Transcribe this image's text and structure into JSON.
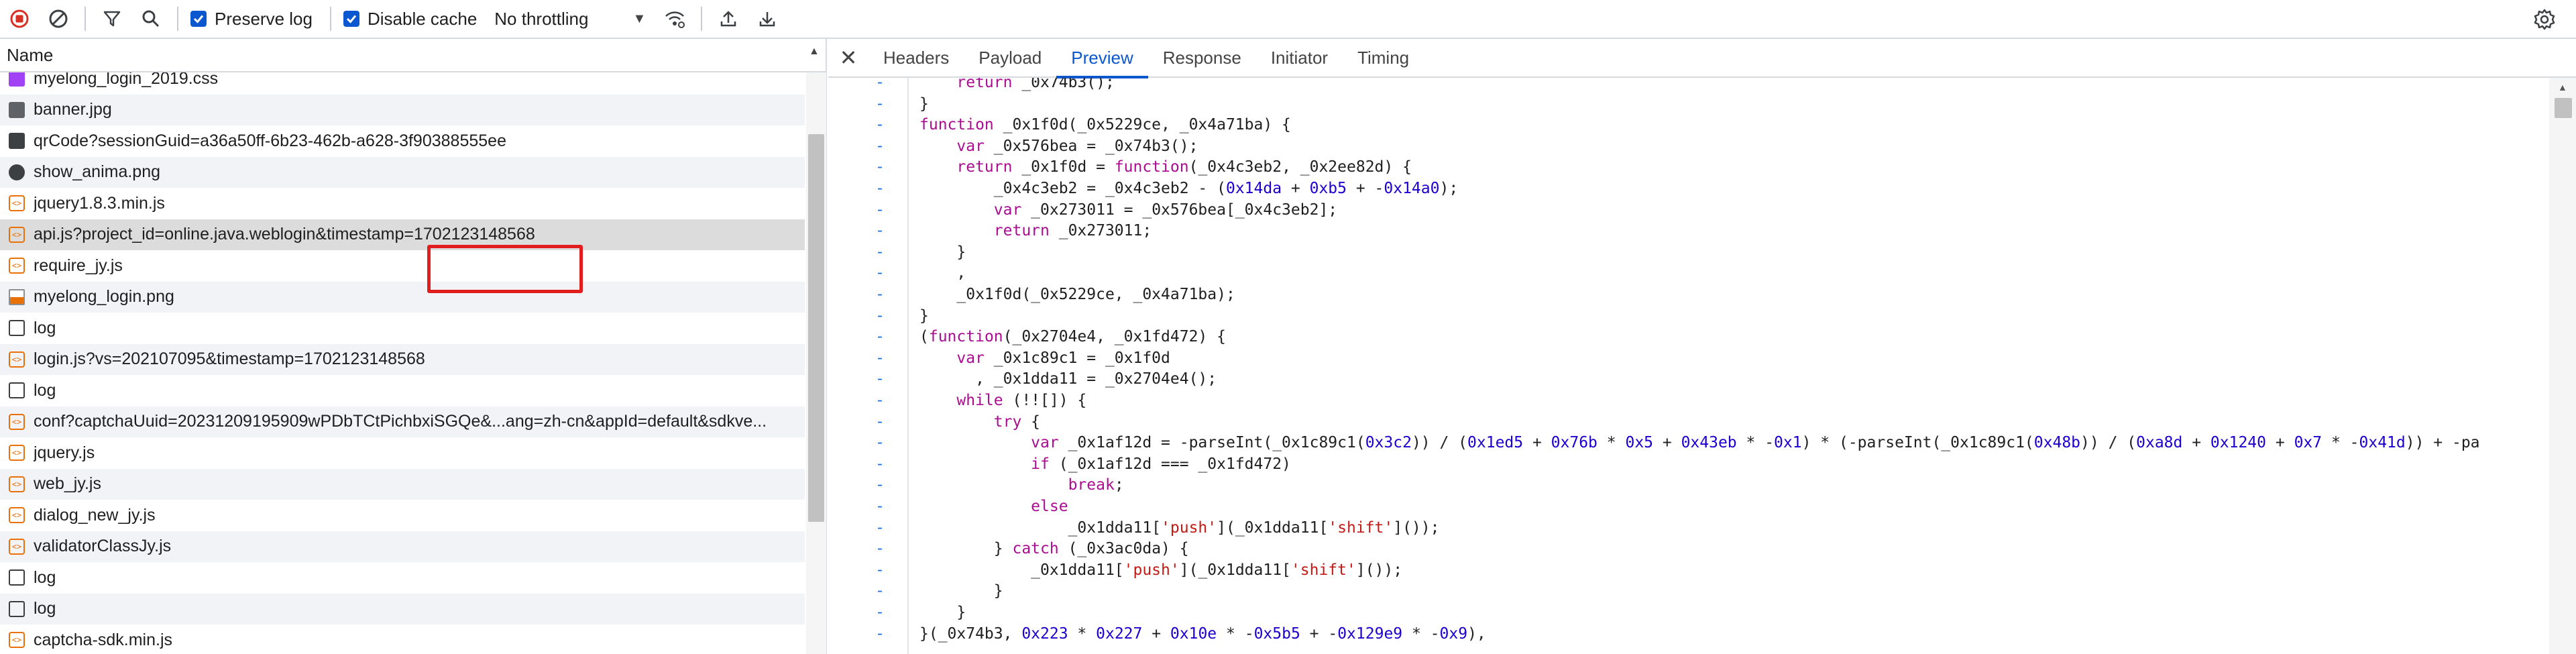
{
  "toolbar": {
    "record_icon": "record-stop-icon",
    "clear_icon": "clear-icon",
    "filter_icon": "filter-icon",
    "search_icon": "search-icon",
    "preserve_log_label": "Preserve log",
    "preserve_log_checked": true,
    "disable_cache_label": "Disable cache",
    "disable_cache_checked": true,
    "throttling_label": "No throttling",
    "network_conditions_icon": "network-conditions-icon",
    "import_icon": "upload-icon",
    "export_icon": "download-icon",
    "settings_icon": "gear-icon"
  },
  "list": {
    "header_name": "Name",
    "rows": [
      {
        "name": "myelong_login_2019.css",
        "type": "css"
      },
      {
        "name": "banner.jpg",
        "type": "img"
      },
      {
        "name": "qrCode?sessionGuid=a36a50ff-6b23-462b-a628-3f90388555ee",
        "type": "qr"
      },
      {
        "name": "show_anima.png",
        "type": "anim"
      },
      {
        "name": "jquery1.8.3.min.js",
        "type": "js"
      },
      {
        "name": "api.js?project_id=online.java.weblogin&timestamp=1702123148568",
        "type": "js"
      },
      {
        "name": "require_jy.js",
        "type": "js"
      },
      {
        "name": "myelong_login.png",
        "type": "png"
      },
      {
        "name": "log",
        "type": "doc"
      },
      {
        "name": "login.js?vs=202107095&timestamp=1702123148568",
        "type": "js"
      },
      {
        "name": "log",
        "type": "doc"
      },
      {
        "name": "conf?captchaUuid=20231209195909wPDbTCtPichbxiSGQe&...ang=zh-cn&appId=default&sdkve...",
        "type": "js"
      },
      {
        "name": "jquery.js",
        "type": "js"
      },
      {
        "name": "web_jy.js",
        "type": "js"
      },
      {
        "name": "dialog_new_jy.js",
        "type": "js"
      },
      {
        "name": "validatorClassJy.js",
        "type": "js"
      },
      {
        "name": "log",
        "type": "doc"
      },
      {
        "name": "log",
        "type": "doc"
      },
      {
        "name": "captcha-sdk.min.js",
        "type": "js"
      }
    ]
  },
  "tabs": {
    "close_icon": "close-icon",
    "items": [
      "Headers",
      "Payload",
      "Preview",
      "Response",
      "Initiator",
      "Timing"
    ],
    "active": "Preview"
  },
  "code": {
    "gutter_marker": "-",
    "lines": [
      [
        [
          "",
          "    "
        ],
        [
          "kw",
          "return"
        ],
        [
          "",
          " _0x74b3();"
        ]
      ],
      [
        [
          "",
          "}"
        ]
      ],
      [
        [
          "kw",
          "function"
        ],
        [
          "",
          " _0x1f0d(_0x5229ce, _0x4a71ba) {"
        ]
      ],
      [
        [
          "",
          "    "
        ],
        [
          "kw",
          "var"
        ],
        [
          "",
          " _0x576bea = _0x74b3();"
        ]
      ],
      [
        [
          "",
          "    "
        ],
        [
          "kw",
          "return"
        ],
        [
          "",
          " _0x1f0d = "
        ],
        [
          "kw",
          "function"
        ],
        [
          "",
          "(_0x4c3eb2, _0x2ee82d) {"
        ]
      ],
      [
        [
          "",
          "        _0x4c3eb2 = _0x4c3eb2 - ("
        ],
        [
          "num",
          "0x14da"
        ],
        [
          "",
          " + "
        ],
        [
          "num",
          "0xb5"
        ],
        [
          "",
          " + -"
        ],
        [
          "num",
          "0x14a0"
        ],
        [
          "",
          ");"
        ]
      ],
      [
        [
          "",
          "        "
        ],
        [
          "kw",
          "var"
        ],
        [
          "",
          " _0x273011 = _0x576bea[_0x4c3eb2];"
        ]
      ],
      [
        [
          "",
          "        "
        ],
        [
          "kw",
          "return"
        ],
        [
          "",
          " _0x273011;"
        ]
      ],
      [
        [
          "",
          "    }"
        ]
      ],
      [
        [
          "",
          "    ,"
        ]
      ],
      [
        [
          "",
          "    _0x1f0d(_0x5229ce, _0x4a71ba);"
        ]
      ],
      [
        [
          "",
          "}"
        ]
      ],
      [
        [
          "",
          "("
        ],
        [
          "kw",
          "function"
        ],
        [
          "",
          "(_0x2704e4, _0x1fd472) {"
        ]
      ],
      [
        [
          "",
          "    "
        ],
        [
          "kw",
          "var"
        ],
        [
          "",
          " _0x1c89c1 = _0x1f0d"
        ]
      ],
      [
        [
          "",
          "      , _0x1dda11 = _0x2704e4();"
        ]
      ],
      [
        [
          "",
          "    "
        ],
        [
          "kw",
          "while"
        ],
        [
          "",
          " (!![]) {"
        ]
      ],
      [
        [
          "",
          "        "
        ],
        [
          "kw",
          "try"
        ],
        [
          "",
          " {"
        ]
      ],
      [
        [
          "",
          "            "
        ],
        [
          "kw",
          "var"
        ],
        [
          "",
          " _0x1af12d = -parseInt(_0x1c89c1("
        ],
        [
          "num",
          "0x3c2"
        ],
        [
          "",
          ")) / ("
        ],
        [
          "num",
          "0x1ed5"
        ],
        [
          "",
          " + "
        ],
        [
          "num",
          "0x76b"
        ],
        [
          "",
          " * "
        ],
        [
          "num",
          "0x5"
        ],
        [
          "",
          " + "
        ],
        [
          "num",
          "0x43eb"
        ],
        [
          "",
          " * -"
        ],
        [
          "num",
          "0x1"
        ],
        [
          "",
          ") * (-parseInt(_0x1c89c1("
        ],
        [
          "num",
          "0x48b"
        ],
        [
          "",
          ")) / ("
        ],
        [
          "num",
          "0xa8d"
        ],
        [
          "",
          " + "
        ],
        [
          "num",
          "0x1240"
        ],
        [
          "",
          " + "
        ],
        [
          "num",
          "0x7"
        ],
        [
          "",
          " * -"
        ],
        [
          "num",
          "0x41d"
        ],
        [
          "",
          ")) + -pa"
        ]
      ],
      [
        [
          "",
          "            "
        ],
        [
          "kw",
          "if"
        ],
        [
          "",
          " (_0x1af12d === _0x1fd472)"
        ]
      ],
      [
        [
          "",
          "                "
        ],
        [
          "kw",
          "break"
        ],
        [
          "",
          ";"
        ]
      ],
      [
        [
          "",
          "            "
        ],
        [
          "kw",
          "else"
        ]
      ],
      [
        [
          "",
          "                _0x1dda11["
        ],
        [
          "str",
          "'push'"
        ],
        [
          "",
          "](_0x1dda11["
        ],
        [
          "str",
          "'shift'"
        ],
        [
          "",
          "]());"
        ]
      ],
      [
        [
          "",
          "        } "
        ],
        [
          "kw",
          "catch"
        ],
        [
          "",
          " (_0x3ac0da) {"
        ]
      ],
      [
        [
          "",
          "            _0x1dda11["
        ],
        [
          "str",
          "'push'"
        ],
        [
          "",
          "](_0x1dda11["
        ],
        [
          "str",
          "'shift'"
        ],
        [
          "",
          "]());"
        ]
      ],
      [
        [
          "",
          "        }"
        ]
      ],
      [
        [
          "",
          "    }"
        ]
      ],
      [
        [
          "",
          "}(_0x74b3, "
        ],
        [
          "num",
          "0x223"
        ],
        [
          "",
          " * "
        ],
        [
          "num",
          "0x227"
        ],
        [
          "",
          " + "
        ],
        [
          "num",
          "0x10e"
        ],
        [
          "",
          " * -"
        ],
        [
          "num",
          "0x5b5"
        ],
        [
          "",
          " + -"
        ],
        [
          "num",
          "0x129e9"
        ],
        [
          "",
          " * -"
        ],
        [
          "num",
          "0x9"
        ],
        [
          "",
          "),"
        ]
      ]
    ]
  }
}
